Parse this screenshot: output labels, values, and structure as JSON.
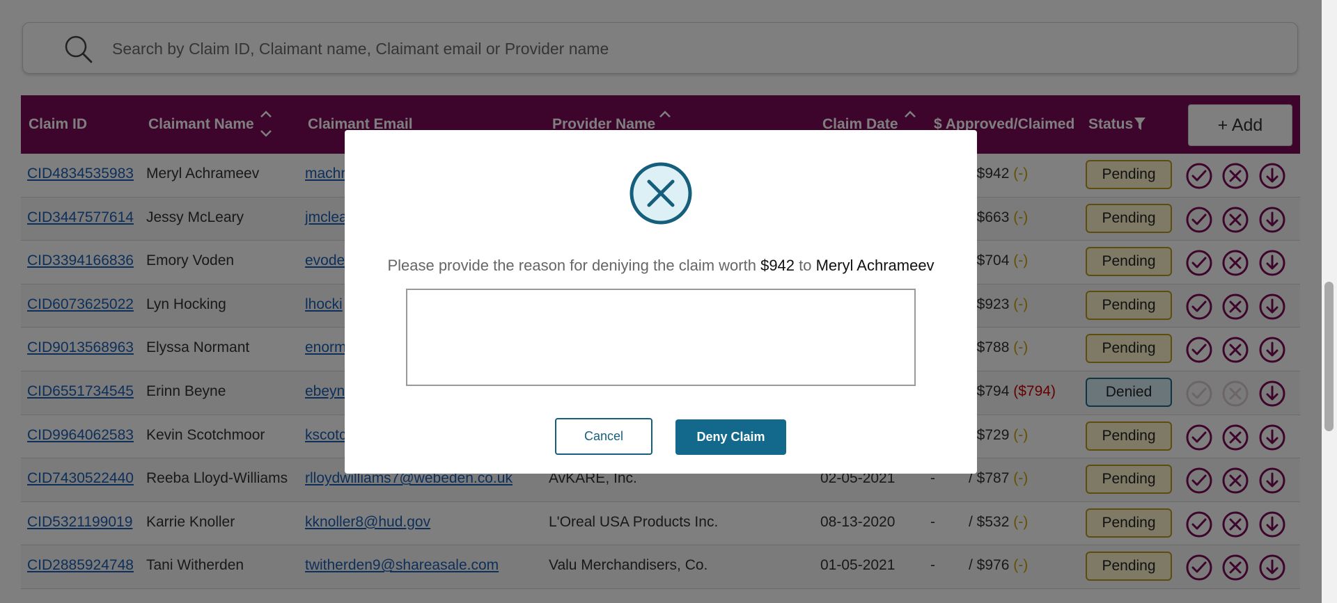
{
  "search": {
    "placeholder": "Search by Claim ID, Claimant name, Claimant email or Provider name"
  },
  "table": {
    "headers": {
      "claim_id": "Claim ID",
      "claimant_name": "Claimant Name",
      "claimant_email": "Claimant Email",
      "provider_name": "Provider Name",
      "claim_date": "Claim Date",
      "amount": "$ Approved/Claimed",
      "status": "Status"
    },
    "add_label": "+ Add",
    "rows": [
      {
        "id": "CID4834535983",
        "name": "Meryl Achrameev",
        "email": "machr",
        "provider": "",
        "date": "",
        "approved": "",
        "claimed": "$942",
        "paren": "(-)",
        "status": "Pending"
      },
      {
        "id": "CID3447577614",
        "name": "Jessy McLeary",
        "email": "jmclea",
        "provider": "",
        "date": "",
        "approved": "",
        "claimed": "$663",
        "paren": "(-)",
        "status": "Pending"
      },
      {
        "id": "CID3394166836",
        "name": "Emory Voden",
        "email": "evode",
        "provider": "",
        "date": "",
        "approved": "",
        "claimed": "$704",
        "paren": "(-)",
        "status": "Pending"
      },
      {
        "id": "CID6073625022",
        "name": "Lyn Hocking",
        "email": "lhocki",
        "provider": "",
        "date": "",
        "approved": "",
        "claimed": "$923",
        "paren": "(-)",
        "status": "Pending"
      },
      {
        "id": "CID9013568963",
        "name": "Elyssa Normant",
        "email": "enorm",
        "provider": "",
        "date": "",
        "approved": "",
        "claimed": "$788",
        "paren": "(-)",
        "status": "Pending"
      },
      {
        "id": "CID6551734545",
        "name": "Erinn Beyne",
        "email": "ebeyn",
        "provider": "",
        "date": "",
        "approved": "",
        "claimed": "$794",
        "paren": "($794)",
        "status": "Denied"
      },
      {
        "id": "CID9964062583",
        "name": "Kevin Scotchmoor",
        "email": "kscotc",
        "provider": "",
        "date": "",
        "approved": "",
        "claimed": "$729",
        "paren": "(-)",
        "status": "Pending"
      },
      {
        "id": "CID7430522440",
        "name": "Reeba Lloyd-Williams",
        "email": "rlloydwilliams7@webeden.co.uk",
        "provider": "AvKARE, Inc.",
        "date": "02-05-2021",
        "approved": "-",
        "claimed": "$787",
        "paren": "(-)",
        "status": "Pending"
      },
      {
        "id": "CID5321199019",
        "name": "Karrie Knoller",
        "email": "kknoller8@hud.gov",
        "provider": "L'Oreal USA Products Inc.",
        "date": "08-13-2020",
        "approved": "-",
        "claimed": "$532",
        "paren": "(-)",
        "status": "Pending"
      },
      {
        "id": "CID2885924748",
        "name": "Tani Witherden",
        "email": "twitherden9@shareasale.com",
        "provider": "Valu Merchandisers, Co.",
        "date": "01-05-2021",
        "approved": "-",
        "claimed": "$976",
        "paren": "(-)",
        "status": "Pending"
      }
    ]
  },
  "modal": {
    "msg_prefix": "Please provide the reason for deniying the claim worth ",
    "amount": "$942",
    "msg_mid": " to ",
    "claimant": "Meryl Achrameev",
    "reason_value": "",
    "cancel_label": "Cancel",
    "deny_label": "Deny Claim"
  },
  "colors": {
    "header_bg": "#7b0a57",
    "link": "#1a5fb4",
    "modal_accent": "#13698c",
    "action_icon": "#7b0a57",
    "pending_border": "#b89a1e",
    "denied_border": "#1f6b8a",
    "denied_paren": "#cc0000"
  },
  "icons": [
    "search-icon",
    "sort-icon",
    "filter-icon",
    "approve-icon",
    "deny-icon",
    "download-icon",
    "close-circle-icon"
  ]
}
